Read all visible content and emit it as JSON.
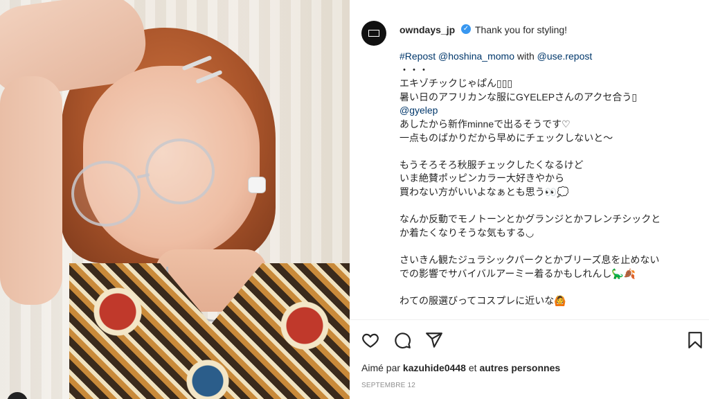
{
  "post": {
    "username": "owndays_jp",
    "verified": "✓",
    "first_line": "Thank you for styling!",
    "repost_tag": "#Repost",
    "repost_user": "@hoshina_momo",
    "repost_with": " with ",
    "repost_app": "@use.repost",
    "lines": [
      "・・・",
      "エキゾチックじゃぱん▯▯▯",
      "暑い日のアフリカンな服にGYELEPさんのアクセ合う▯",
      "@gyelep",
      "あしたから新作minneで出るそうです♡",
      "一点ものばかりだから早めにチェックしないと〜",
      "",
      "もうそろそろ秋服チェックしたくなるけど",
      "いま絶賛ポッピンカラー大好きやから",
      "買わない方がいいよなぁとも思う👀💭",
      "",
      "なんか反動でモノトーンとかグランジとかフレンチシックと",
      "か着たくなりそうな気もする◡",
      "",
      "さいきん観たジュラシックパークとかブリーズ息を止めない",
      "での影響でサバイバルアーミー着るかもしれんし🦕🍂",
      "",
      "わての服選びってコスプレに近いな🙆"
    ],
    "likes_prefix": "Aimé par ",
    "likes_user": "kazuhide0448",
    "likes_mid": " et ",
    "likes_suffix": "autres personnes",
    "date": "SEPTEMBRE 12"
  },
  "icons": {
    "like": "heart-icon",
    "comment": "comment-icon",
    "share": "share-icon",
    "save": "bookmark-icon"
  },
  "colors": {
    "link": "#00376b",
    "verified": "#3897f0",
    "text": "#262626",
    "muted": "#8e8e8e"
  }
}
